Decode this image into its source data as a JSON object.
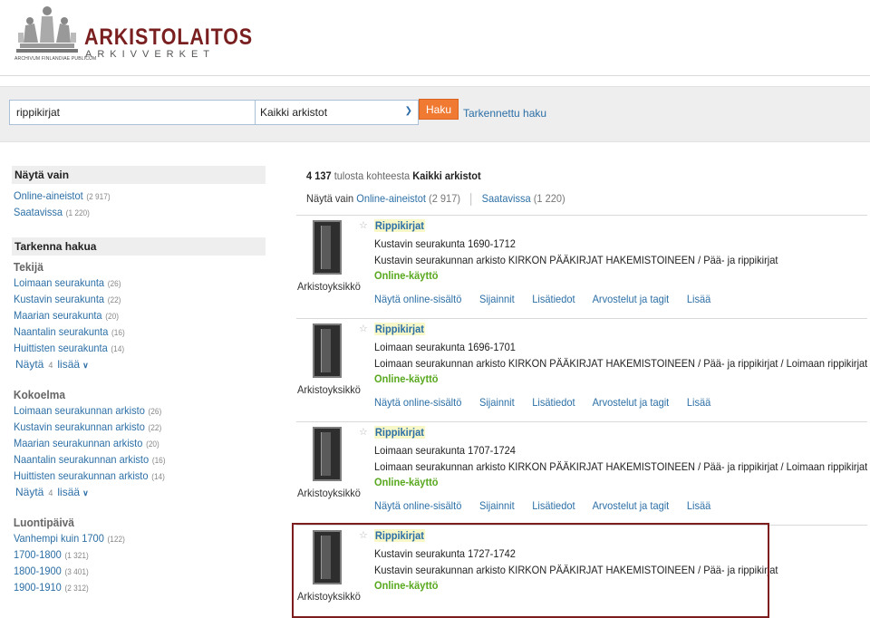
{
  "header": {
    "logo_title": "ARKISTOLAITOS",
    "logo_subtitle": "ARKIVVERKET",
    "logo_caption": "ARCHIVUM FINLANDIAE PUBLICUM"
  },
  "search": {
    "query": "rippikirjat",
    "scope": "Kaikki arkistot",
    "button": "Haku",
    "advanced": "Tarkennettu haku"
  },
  "sidebar": {
    "show_only": {
      "title": "Näytä vain",
      "items": [
        {
          "label": "Online-aineistot",
          "count": "(2 917)"
        },
        {
          "label": "Saatavissa",
          "count": "(1 220)"
        }
      ]
    },
    "refine": {
      "title": "Tarkenna hakua",
      "groups": [
        {
          "title": "Tekijä",
          "items": [
            {
              "label": "Loimaan seurakunta",
              "count": "(26)"
            },
            {
              "label": "Kustavin seurakunta",
              "count": "(22)"
            },
            {
              "label": "Maarian seurakunta",
              "count": "(20)"
            },
            {
              "label": "Naantalin seurakunta",
              "count": "(16)"
            },
            {
              "label": "Huittisten seurakunta",
              "count": "(14)"
            }
          ],
          "more_label": "Näytä",
          "more_count": "4",
          "more_link": "lisää"
        },
        {
          "title": "Kokoelma",
          "items": [
            {
              "label": "Loimaan seurakunnan arkisto",
              "count": "(26)"
            },
            {
              "label": "Kustavin seurakunnan arkisto",
              "count": "(22)"
            },
            {
              "label": "Maarian seurakunnan arkisto",
              "count": "(20)"
            },
            {
              "label": "Naantalin seurakunnan arkisto",
              "count": "(16)"
            },
            {
              "label": "Huittisten seurakunnan arkisto",
              "count": "(14)"
            }
          ],
          "more_label": "Näytä",
          "more_count": "4",
          "more_link": "lisää"
        },
        {
          "title": "Luontipäivä",
          "items": [
            {
              "label": "Vanhempi kuin 1700",
              "count": "(122)"
            },
            {
              "label": "1700-1800",
              "count": "(1 321)"
            },
            {
              "label": "1800-1900",
              "count": "(3 401)"
            },
            {
              "label": "1900-1910",
              "count": "(2 312)"
            }
          ]
        }
      ]
    }
  },
  "results": {
    "summary_count": "4 137",
    "summary_mid": "tulosta kohteesta",
    "summary_scope": "Kaikki arkistot",
    "filter_prefix": "Näytä vain",
    "filters": [
      {
        "label": "Online-aineistot",
        "count": "(2 917)"
      },
      {
        "label": "Saatavissa",
        "count": "(1 220)"
      }
    ],
    "items": [
      {
        "title": "Rippikirjat",
        "line1": "Kustavin seurakunta 1690-1712",
        "line2": "Kustavin seurakunnan arkisto KIRKON PÄÄKIRJAT HAKEMISTOINEEN / Pää- ja rippikirjat",
        "online": "Online-käyttö",
        "type": "Arkistoyksikkö",
        "actions": [
          "Näytä online-sisältö",
          "Sijainnit",
          "Lisätiedot",
          "Arvostelut ja tagit",
          "Lisää"
        ]
      },
      {
        "title": "Rippikirjat",
        "line1": "Loimaan seurakunta 1696-1701",
        "line2": "Loimaan seurakunnan arkisto KIRKON PÄÄKIRJAT HAKEMISTOINEEN / Pää- ja rippikirjat / Loimaan rippikirjat",
        "online": "Online-käyttö",
        "type": "Arkistoyksikkö",
        "actions": [
          "Näytä online-sisältö",
          "Sijainnit",
          "Lisätiedot",
          "Arvostelut ja tagit",
          "Lisää"
        ]
      },
      {
        "title": "Rippikirjat",
        "line1": "Loimaan seurakunta 1707-1724",
        "line2": "Loimaan seurakunnan arkisto KIRKON PÄÄKIRJAT HAKEMISTOINEEN / Pää- ja rippikirjat / Loimaan rippikirjat",
        "online": "Online-käyttö",
        "type": "Arkistoyksikkö",
        "actions": [
          "Näytä online-sisältö",
          "Sijainnit",
          "Lisätiedot",
          "Arvostelut ja tagit",
          "Lisää"
        ]
      },
      {
        "title": "Rippikirjat",
        "line1": "Kustavin seurakunta 1727-1742",
        "line2": "Kustavin seurakunnan arkisto KIRKON PÄÄKIRJAT HAKEMISTOINEEN / Pää- ja rippikirjat",
        "online": "Online-käyttö",
        "type": "Arkistoyksikkö"
      }
    ]
  },
  "colors": {
    "link": "#2c6fa6",
    "brand": "#7a1f1f",
    "search_button": "#f07a32",
    "online": "#58a81e",
    "highlight_border": "#7d1d1d"
  }
}
